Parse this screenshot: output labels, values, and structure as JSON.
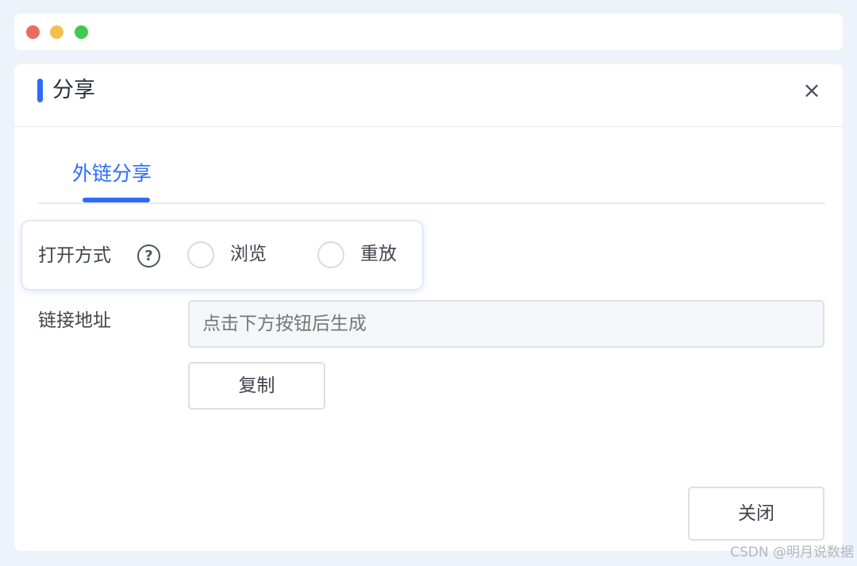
{
  "window": {
    "controls": [
      "close",
      "minimize",
      "maximize"
    ]
  },
  "dialog": {
    "title": "分享",
    "close_icon": "close-icon",
    "tabs": [
      {
        "label": "外链分享",
        "active": true
      }
    ],
    "open_mode": {
      "label": "打开方式",
      "help_icon_glyph": "?",
      "options": [
        {
          "label": "浏览",
          "selected": false
        },
        {
          "label": "重放",
          "selected": false
        }
      ]
    },
    "link": {
      "label": "链接地址",
      "value": "",
      "placeholder": "点击下方按钮后生成"
    },
    "copy_label": "复制",
    "close_label": "关闭"
  },
  "watermark": "CSDN @明月说数据",
  "colors": {
    "accent": "#2f6bf6",
    "background": "#eef2fb"
  }
}
